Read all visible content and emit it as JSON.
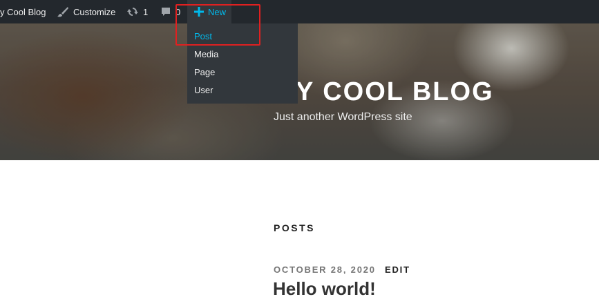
{
  "admin_bar": {
    "site_name": "y Cool Blog",
    "customize_label": "Customize",
    "updates_count": "1",
    "comments_count": "0",
    "new_label": "New",
    "new_menu": {
      "items": [
        {
          "label": "Post",
          "active": true
        },
        {
          "label": "Media",
          "active": false
        },
        {
          "label": "Page",
          "active": false
        },
        {
          "label": "User",
          "active": false
        }
      ]
    }
  },
  "header": {
    "site_title": "Y COOL BLOG",
    "tagline": "Just another WordPress site"
  },
  "main": {
    "section_heading": "POSTS",
    "post": {
      "date": "OCTOBER 28, 2020",
      "edit_label": "EDIT",
      "title": "Hello world!"
    }
  },
  "colors": {
    "admin_bar_bg": "#23282d",
    "submenu_bg": "#32373c",
    "accent": "#00b9eb",
    "highlight_border": "#e02020"
  },
  "icons": [
    "brush-icon",
    "update-icon",
    "comment-icon",
    "plus-icon"
  ]
}
